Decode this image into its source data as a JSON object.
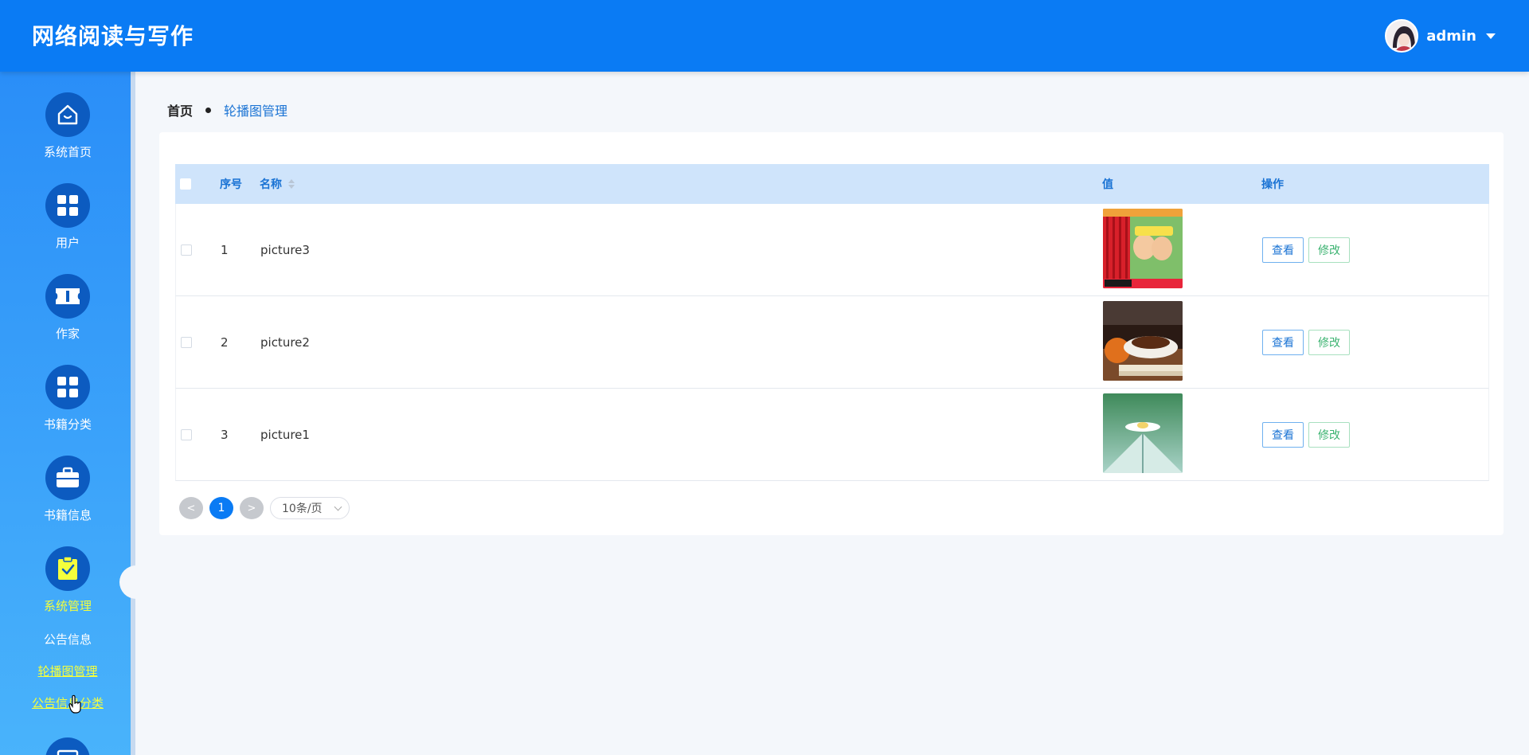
{
  "app": {
    "title": "网络阅读与写作"
  },
  "user": {
    "name": "admin",
    "avatar_icon": "user-avatar"
  },
  "sidebar": {
    "items": [
      {
        "label": "系统首页",
        "icon": "home-icon"
      },
      {
        "label": "用户",
        "icon": "grid-icon"
      },
      {
        "label": "作家",
        "icon": "ticket-icon"
      },
      {
        "label": "书籍分类",
        "icon": "grid-icon"
      },
      {
        "label": "书籍信息",
        "icon": "briefcase-icon"
      },
      {
        "label": "系统管理",
        "icon": "clipboard-check-icon",
        "active": true
      }
    ],
    "sub_items": [
      {
        "label": "公告信息"
      },
      {
        "label": "轮播图管理",
        "active": true
      },
      {
        "label": "公告信息分类"
      }
    ]
  },
  "breadcrumb": {
    "home": "首页",
    "current": "轮播图管理"
  },
  "table": {
    "headers": {
      "index": "序号",
      "name": "名称",
      "value": "值",
      "ops": "操作"
    },
    "rows": [
      {
        "index": "1",
        "name": "picture3",
        "image": "book-cover-cartoon"
      },
      {
        "index": "2",
        "name": "picture2",
        "image": "coffee-books"
      },
      {
        "index": "3",
        "name": "picture1",
        "image": "flower-on-book"
      }
    ],
    "view_label": "查看",
    "edit_label": "修改"
  },
  "pagination": {
    "prev": "<",
    "current": "1",
    "next": ">",
    "page_size": "10条/页"
  },
  "colors": {
    "header_bg": "#0a7bf4",
    "sidebar_active": "#f5ff3c",
    "table_header_bg": "#cfe4fb",
    "link": "#1a73d4",
    "edit": "#3cb371"
  }
}
